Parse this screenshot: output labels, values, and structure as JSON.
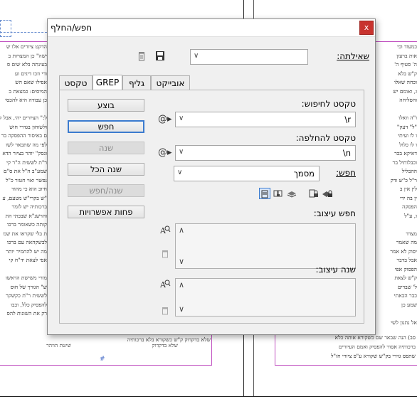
{
  "dialog": {
    "title": "חפש/החלף",
    "close_label": "x",
    "query_label": "שאילתה:",
    "query_value": "",
    "tabs": [
      "טקסט",
      "GREP",
      "גליף",
      "אובייקט"
    ],
    "active_tab": "GREP",
    "find_label": "טקסט לחיפוש:",
    "find_value": "\\r",
    "change_label": "טקסט להחלפה:",
    "change_value": "\\n",
    "search_label": "חפש:",
    "search_value": "מסמך",
    "find_format_label": "חפש עיצוב:",
    "change_format_label": "שנה עיצוב:",
    "buttons": {
      "done": "בוצע",
      "find": "חפש",
      "change": "שנה",
      "change_all": "שנה הכל",
      "change_find": "שנה/חפש",
      "fewer_options": "פחות אפשרויות"
    }
  },
  "doc": {
    "left_lines": [
      "הדקט ציורים אלו ש",
      "ישה\" כן המצויות ב",
      "בעינתה בלא שום ס",
      "ודי וזכו דיגים וע",
      "אפילו שאם הש",
      "המיסים: כמצאת ב",
      "כן עבודה היא להכסי",
      "",
      "ל:\" הציורים יהי, אבל ל",
      "ולשוחון בגדרי חוש",
      "ם באיסור ההפסקה בר",
      "לפי מה שתבאר לשו",
      "ונסק\" יוהר בציור הדא",
      "ר\"ת לששית ה\"ר קי",
      "שמע\"ב ה\"ל את ס\"ם",
      "נפשר ואוי חטור כ\"ל",
      "חיוב הוא כי מהוד",
      "\"ש בקרי\"ש מטעם, ע",
      "ברכותיה יש לומר",
      "והרשנ\"א שבכתי הת",
      "קותה כשאומר ברכו",
      "ת בלי שקראו את שמ",
      "לבשקהאה עם ברכו",
      "מה יש להחמיר יותר",
      "אפי לצאת יד\"ח קי",
      "",
      "מורי משישת הראשו",
      "ש\" הגורך של חוס",
      "לששית ר\"ת כקשקר",
      "להפסיק כלל, וכבו",
      "רק את השונות להס"
    ],
    "left_footer_a": "שלא בדקדוק",
    "left_footer_b": "שיטת הווהר",
    "right_lines": [
      "כמעוד וכי",
      "אות ברעון",
      "ה' סעיף ה'",
      "ק\"ש בלא",
      "וכחה שאלו",
      "ו, ואומם יש",
      "והסליחה",
      "",
      "ו\"ה וואלו",
      "\"ל\" דעק\"",
      "ו לו ועיתי",
      "ו לו כלול",
      "דאיקא בכר",
      "וכבלותיל בר",
      "ההבליל",
      "ר\"ל כ\"ש ודק",
      "לין אין ב",
      "ין בה ידי",
      "הפסקה",
      "ו, ע\"ל",
      "",
      "מצדד",
      "מה שאמר",
      "יסוק לא אמר",
      "אבל בדבר",
      "הפסוק אפי",
      "ק\"ש לצאת",
      "ל' שבדים",
      "כבר הבאתי",
      "שמע כן",
      "",
      "אל נתנון לשי",
      "שאו החמיר",
      "הפסוק אפי",
      "ל' לא להפסיק",
      "להפסיק"
    ],
    "bottom_right_a": "סב) הנה שבאר שם כשקורא אותה כלא",
    "bottom_right_b": "ברכותיה אסור להפסיק ואמם העיורים",
    "bottom_right_c": "שתפס גזירי בק\"ש שקורא ע\"פ ציורי חז\"ל",
    "footer_left": "שלא בדקדוק ק\"ש כשקורא בלא ברכותיה",
    "footer_right_label": "והבר ש"
  }
}
